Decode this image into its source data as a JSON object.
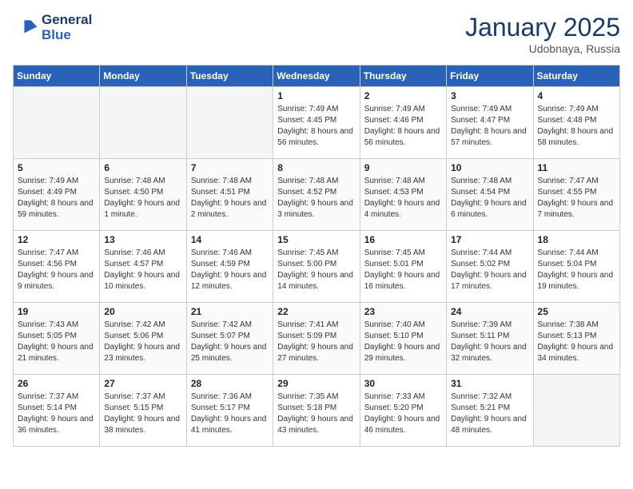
{
  "header": {
    "logo_line1": "General",
    "logo_line2": "Blue",
    "month_title": "January 2025",
    "location": "Udobnaya, Russia"
  },
  "days_of_week": [
    "Sunday",
    "Monday",
    "Tuesday",
    "Wednesday",
    "Thursday",
    "Friday",
    "Saturday"
  ],
  "weeks": [
    [
      {
        "day": "",
        "empty": true
      },
      {
        "day": "",
        "empty": true
      },
      {
        "day": "",
        "empty": true
      },
      {
        "day": "1",
        "sunrise": "7:49 AM",
        "sunset": "4:45 PM",
        "daylight": "8 hours and 56 minutes."
      },
      {
        "day": "2",
        "sunrise": "7:49 AM",
        "sunset": "4:46 PM",
        "daylight": "8 hours and 56 minutes."
      },
      {
        "day": "3",
        "sunrise": "7:49 AM",
        "sunset": "4:47 PM",
        "daylight": "8 hours and 57 minutes."
      },
      {
        "day": "4",
        "sunrise": "7:49 AM",
        "sunset": "4:48 PM",
        "daylight": "8 hours and 58 minutes."
      }
    ],
    [
      {
        "day": "5",
        "sunrise": "7:49 AM",
        "sunset": "4:49 PM",
        "daylight": "8 hours and 59 minutes."
      },
      {
        "day": "6",
        "sunrise": "7:48 AM",
        "sunset": "4:50 PM",
        "daylight": "9 hours and 1 minute."
      },
      {
        "day": "7",
        "sunrise": "7:48 AM",
        "sunset": "4:51 PM",
        "daylight": "9 hours and 2 minutes."
      },
      {
        "day": "8",
        "sunrise": "7:48 AM",
        "sunset": "4:52 PM",
        "daylight": "9 hours and 3 minutes."
      },
      {
        "day": "9",
        "sunrise": "7:48 AM",
        "sunset": "4:53 PM",
        "daylight": "9 hours and 4 minutes."
      },
      {
        "day": "10",
        "sunrise": "7:48 AM",
        "sunset": "4:54 PM",
        "daylight": "9 hours and 6 minutes."
      },
      {
        "day": "11",
        "sunrise": "7:47 AM",
        "sunset": "4:55 PM",
        "daylight": "9 hours and 7 minutes."
      }
    ],
    [
      {
        "day": "12",
        "sunrise": "7:47 AM",
        "sunset": "4:56 PM",
        "daylight": "9 hours and 9 minutes."
      },
      {
        "day": "13",
        "sunrise": "7:46 AM",
        "sunset": "4:57 PM",
        "daylight": "9 hours and 10 minutes."
      },
      {
        "day": "14",
        "sunrise": "7:46 AM",
        "sunset": "4:59 PM",
        "daylight": "9 hours and 12 minutes."
      },
      {
        "day": "15",
        "sunrise": "7:45 AM",
        "sunset": "5:00 PM",
        "daylight": "9 hours and 14 minutes."
      },
      {
        "day": "16",
        "sunrise": "7:45 AM",
        "sunset": "5:01 PM",
        "daylight": "9 hours and 16 minutes."
      },
      {
        "day": "17",
        "sunrise": "7:44 AM",
        "sunset": "5:02 PM",
        "daylight": "9 hours and 17 minutes."
      },
      {
        "day": "18",
        "sunrise": "7:44 AM",
        "sunset": "5:04 PM",
        "daylight": "9 hours and 19 minutes."
      }
    ],
    [
      {
        "day": "19",
        "sunrise": "7:43 AM",
        "sunset": "5:05 PM",
        "daylight": "9 hours and 21 minutes."
      },
      {
        "day": "20",
        "sunrise": "7:42 AM",
        "sunset": "5:06 PM",
        "daylight": "9 hours and 23 minutes."
      },
      {
        "day": "21",
        "sunrise": "7:42 AM",
        "sunset": "5:07 PM",
        "daylight": "9 hours and 25 minutes."
      },
      {
        "day": "22",
        "sunrise": "7:41 AM",
        "sunset": "5:09 PM",
        "daylight": "9 hours and 27 minutes."
      },
      {
        "day": "23",
        "sunrise": "7:40 AM",
        "sunset": "5:10 PM",
        "daylight": "9 hours and 29 minutes."
      },
      {
        "day": "24",
        "sunrise": "7:39 AM",
        "sunset": "5:11 PM",
        "daylight": "9 hours and 32 minutes."
      },
      {
        "day": "25",
        "sunrise": "7:38 AM",
        "sunset": "5:13 PM",
        "daylight": "9 hours and 34 minutes."
      }
    ],
    [
      {
        "day": "26",
        "sunrise": "7:37 AM",
        "sunset": "5:14 PM",
        "daylight": "9 hours and 36 minutes."
      },
      {
        "day": "27",
        "sunrise": "7:37 AM",
        "sunset": "5:15 PM",
        "daylight": "9 hours and 38 minutes."
      },
      {
        "day": "28",
        "sunrise": "7:36 AM",
        "sunset": "5:17 PM",
        "daylight": "9 hours and 41 minutes."
      },
      {
        "day": "29",
        "sunrise": "7:35 AM",
        "sunset": "5:18 PM",
        "daylight": "9 hours and 43 minutes."
      },
      {
        "day": "30",
        "sunrise": "7:33 AM",
        "sunset": "5:20 PM",
        "daylight": "9 hours and 46 minutes."
      },
      {
        "day": "31",
        "sunrise": "7:32 AM",
        "sunset": "5:21 PM",
        "daylight": "9 hours and 48 minutes."
      },
      {
        "day": "",
        "empty": true
      }
    ]
  ]
}
